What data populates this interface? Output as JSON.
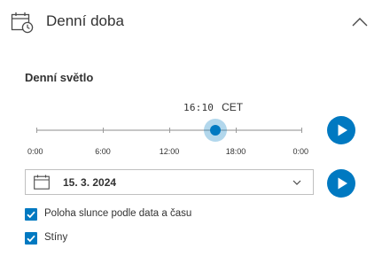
{
  "header": {
    "title": "Denní doba",
    "icon": "calendar-clock-icon",
    "collapse_icon": "chevron-up-icon"
  },
  "daylight": {
    "title": "Denní světlo",
    "time": "16:10",
    "timezone": "CET",
    "slider": {
      "ticks": [
        "0:00",
        "6:00",
        "12:00",
        "18:00",
        "0:00"
      ],
      "value_hours": 16.17,
      "range_hours": [
        0,
        24
      ]
    },
    "play_time_icon": "play-icon",
    "date": "15. 3. 2024",
    "date_icon": "calendar-icon",
    "date_dropdown_icon": "chevron-down-icon",
    "play_date_icon": "play-icon"
  },
  "options": [
    {
      "label": "Poloha slunce podle data a času",
      "checked": true
    },
    {
      "label": "Stíny",
      "checked": true
    }
  ],
  "colors": {
    "accent": "#0079c1",
    "text": "#323232",
    "track": "#c6c6c6",
    "border": "#c0c0c0"
  }
}
